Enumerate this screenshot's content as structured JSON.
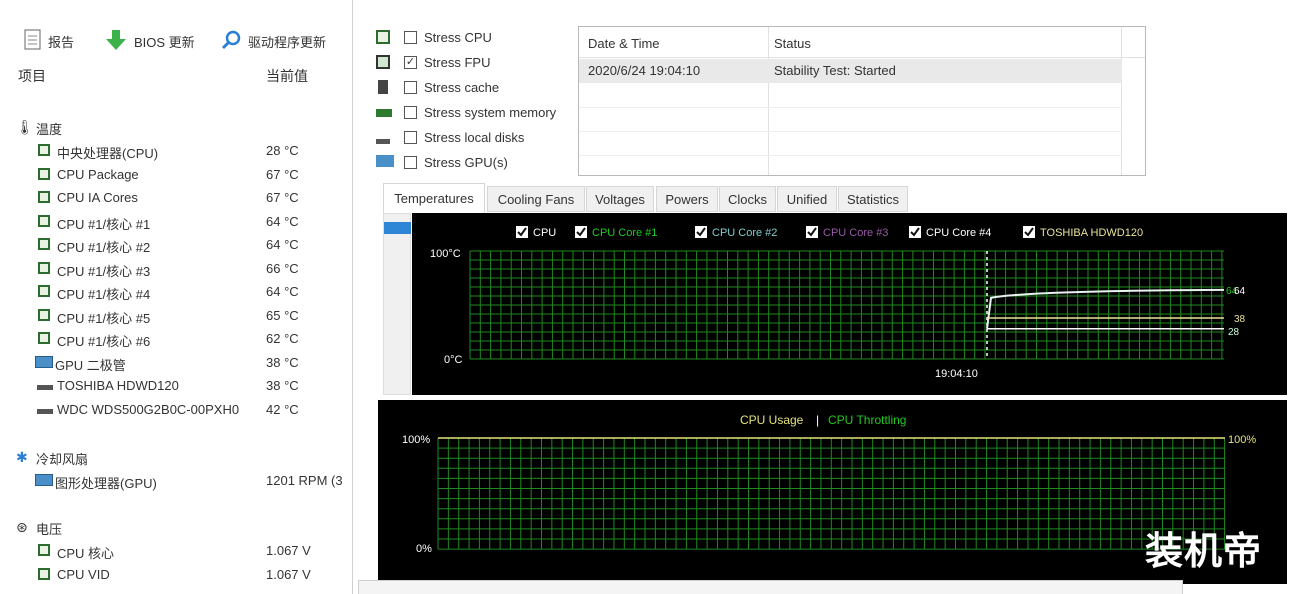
{
  "toolbar": {
    "report_label": "报告",
    "bios_label": "BIOS 更新",
    "driver_label": "驱动程序更新"
  },
  "sensor_list": {
    "col_item": "项目",
    "col_value": "当前值",
    "groups": [
      {
        "label": "温度",
        "icon": "thermometer-icon",
        "items": [
          {
            "label": "中央处理器(CPU)",
            "value": "28 °C",
            "icon": "cpu-icon"
          },
          {
            "label": "CPU Package",
            "value": "67 °C",
            "icon": "cpu-icon"
          },
          {
            "label": "CPU IA Cores",
            "value": "67 °C",
            "icon": "cpu-icon"
          },
          {
            "label": "CPU #1/核心 #1",
            "value": "64 °C",
            "icon": "cpu-icon"
          },
          {
            "label": "CPU #1/核心 #2",
            "value": "64 °C",
            "icon": "cpu-icon"
          },
          {
            "label": "CPU #1/核心 #3",
            "value": "66 °C",
            "icon": "cpu-icon"
          },
          {
            "label": "CPU #1/核心 #4",
            "value": "64 °C",
            "icon": "cpu-icon"
          },
          {
            "label": "CPU #1/核心 #5",
            "value": "65 °C",
            "icon": "cpu-icon"
          },
          {
            "label": "CPU #1/核心 #6",
            "value": "62 °C",
            "icon": "cpu-icon"
          },
          {
            "label": "GPU 二极管",
            "value": "38 °C",
            "icon": "gpu-icon"
          },
          {
            "label": "TOSHIBA HDWD120",
            "value": "38 °C",
            "icon": "disk-icon"
          },
          {
            "label": "WDC WDS500G2B0C-00PXH0",
            "value": "42 °C",
            "icon": "disk-icon"
          }
        ]
      },
      {
        "label": "冷却风扇",
        "icon": "fan-icon",
        "items": [
          {
            "label": "图形处理器(GPU)",
            "value": "1201 RPM  (3",
            "icon": "gpu-icon"
          }
        ]
      },
      {
        "label": "电压",
        "icon": "voltage-icon",
        "items": [
          {
            "label": "CPU 核心",
            "value": "1.067 V",
            "icon": "cpu-icon"
          },
          {
            "label": "CPU VID",
            "value": "1.067 V",
            "icon": "cpu-icon"
          }
        ]
      }
    ]
  },
  "stress_options": [
    {
      "label": "Stress CPU",
      "checked": false,
      "icon": "cpu-chip-icon"
    },
    {
      "label": "Stress FPU",
      "checked": true,
      "icon": "fpu-icon"
    },
    {
      "label": "Stress cache",
      "checked": false,
      "icon": "cache-icon"
    },
    {
      "label": "Stress system memory",
      "checked": false,
      "icon": "memory-icon"
    },
    {
      "label": "Stress local disks",
      "checked": false,
      "icon": "disk-icon"
    },
    {
      "label": "Stress GPU(s)",
      "checked": false,
      "icon": "gpu-icon"
    }
  ],
  "log": {
    "col_datetime": "Date & Time",
    "col_status": "Status",
    "rows": [
      {
        "datetime": "2020/6/24 19:04:10",
        "status": "Stability Test: Started"
      }
    ]
  },
  "tabs": [
    "Temperatures",
    "Cooling Fans",
    "Voltages",
    "Powers",
    "Clocks",
    "Unified",
    "Statistics"
  ],
  "active_tab": "Temperatures",
  "temp_graph": {
    "legend": [
      {
        "label": "CPU",
        "color": "#ffffff"
      },
      {
        "label": "CPU Core #1",
        "color": "#22c922"
      },
      {
        "label": "CPU Core #2",
        "color": "#7fd0d0"
      },
      {
        "label": "CPU Core #3",
        "color": "#9a5aa8"
      },
      {
        "label": "CPU Core #4",
        "color": "#ffffff"
      },
      {
        "label": "TOSHIBA HDWD120",
        "color": "#e8e29a"
      }
    ],
    "y_top_label": "100°C",
    "y_bottom_label": "0°C",
    "time_label": "19:04:10",
    "right_labels": [
      "64",
      "64",
      "38",
      "28"
    ],
    "grid_color": "#1f8a1f",
    "series": [
      {
        "name": "CPU",
        "start_value": 28,
        "end_value": 64
      },
      {
        "name": "TOSHIBA HDWD120",
        "start_value": 38,
        "end_value": 38
      },
      {
        "name": "CPU (baseline)",
        "start_value": 28,
        "end_value": 28
      }
    ]
  },
  "usage_graph": {
    "legend_usage": "CPU Usage",
    "legend_sep": "|",
    "legend_throttling": "CPU Throttling",
    "usage_color": "#e6e27a",
    "throttling_color": "#22c922",
    "y_top_label": "100%",
    "y_bottom_label": "0%",
    "right_top_label": "100%",
    "grid_color": "#1f8a1f",
    "cpu_usage_percent": 100,
    "cpu_throttling_percent": 0
  },
  "watermark": "装机帝"
}
